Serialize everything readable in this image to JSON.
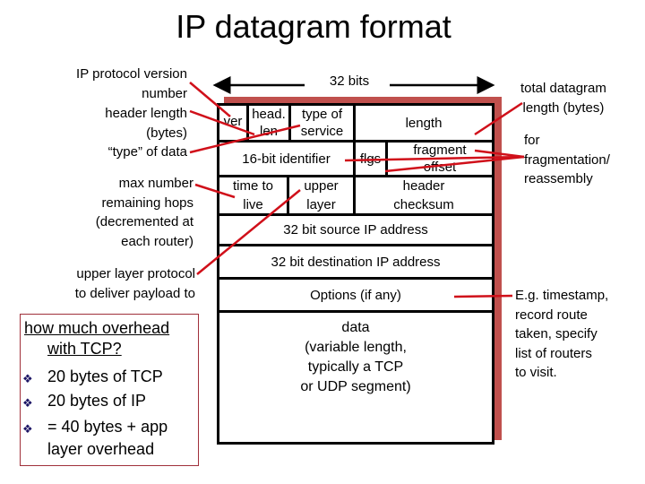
{
  "title": "IP datagram format",
  "width_label": "32 bits",
  "left_labels": {
    "version": [
      "IP protocol version",
      "number"
    ],
    "header_length": [
      "header length",
      "(bytes)"
    ],
    "type_of_data": [
      "“type” of data"
    ],
    "ttl": [
      "max number",
      "remaining hops",
      "(decremented at",
      "each router)"
    ],
    "upper_layer": [
      "upper layer protocol",
      "to deliver payload to"
    ]
  },
  "right_labels": {
    "total_length": [
      "total datagram",
      "length (bytes)"
    ],
    "fragmentation": [
      "for",
      "fragmentation/",
      "reassembly"
    ],
    "options": [
      "E.g. timestamp,",
      "record route",
      "taken, specify",
      "list of routers",
      "to visit."
    ]
  },
  "fields": {
    "ver": "ver",
    "head_len": [
      "head.",
      "len"
    ],
    "tos": [
      "type of",
      "service"
    ],
    "length": "length",
    "identifier": "16-bit identifier",
    "flags": "flgs",
    "frag_offset": [
      "fragment",
      "offset"
    ],
    "ttl": [
      "time to",
      "live"
    ],
    "upper_layer": [
      "upper",
      "layer"
    ],
    "checksum": [
      "header",
      "checksum"
    ],
    "src": "32 bit source IP address",
    "dst": "32 bit destination IP address",
    "options": "Options (if any)",
    "data": [
      "data",
      "(variable length,",
      "typically a TCP",
      "or UDP segment)"
    ]
  },
  "overhead_box": {
    "heading": [
      "how much overhead",
      "with TCP?"
    ],
    "bullet_icon": "diamond-dots-bullet",
    "items": [
      "20 bytes of TCP",
      "20 bytes of IP",
      "= 40 bytes + app",
      "layer overhead"
    ]
  },
  "colors": {
    "accent_red": "#d0101a",
    "shadow_red": "#c0504d",
    "border": "#000000"
  }
}
